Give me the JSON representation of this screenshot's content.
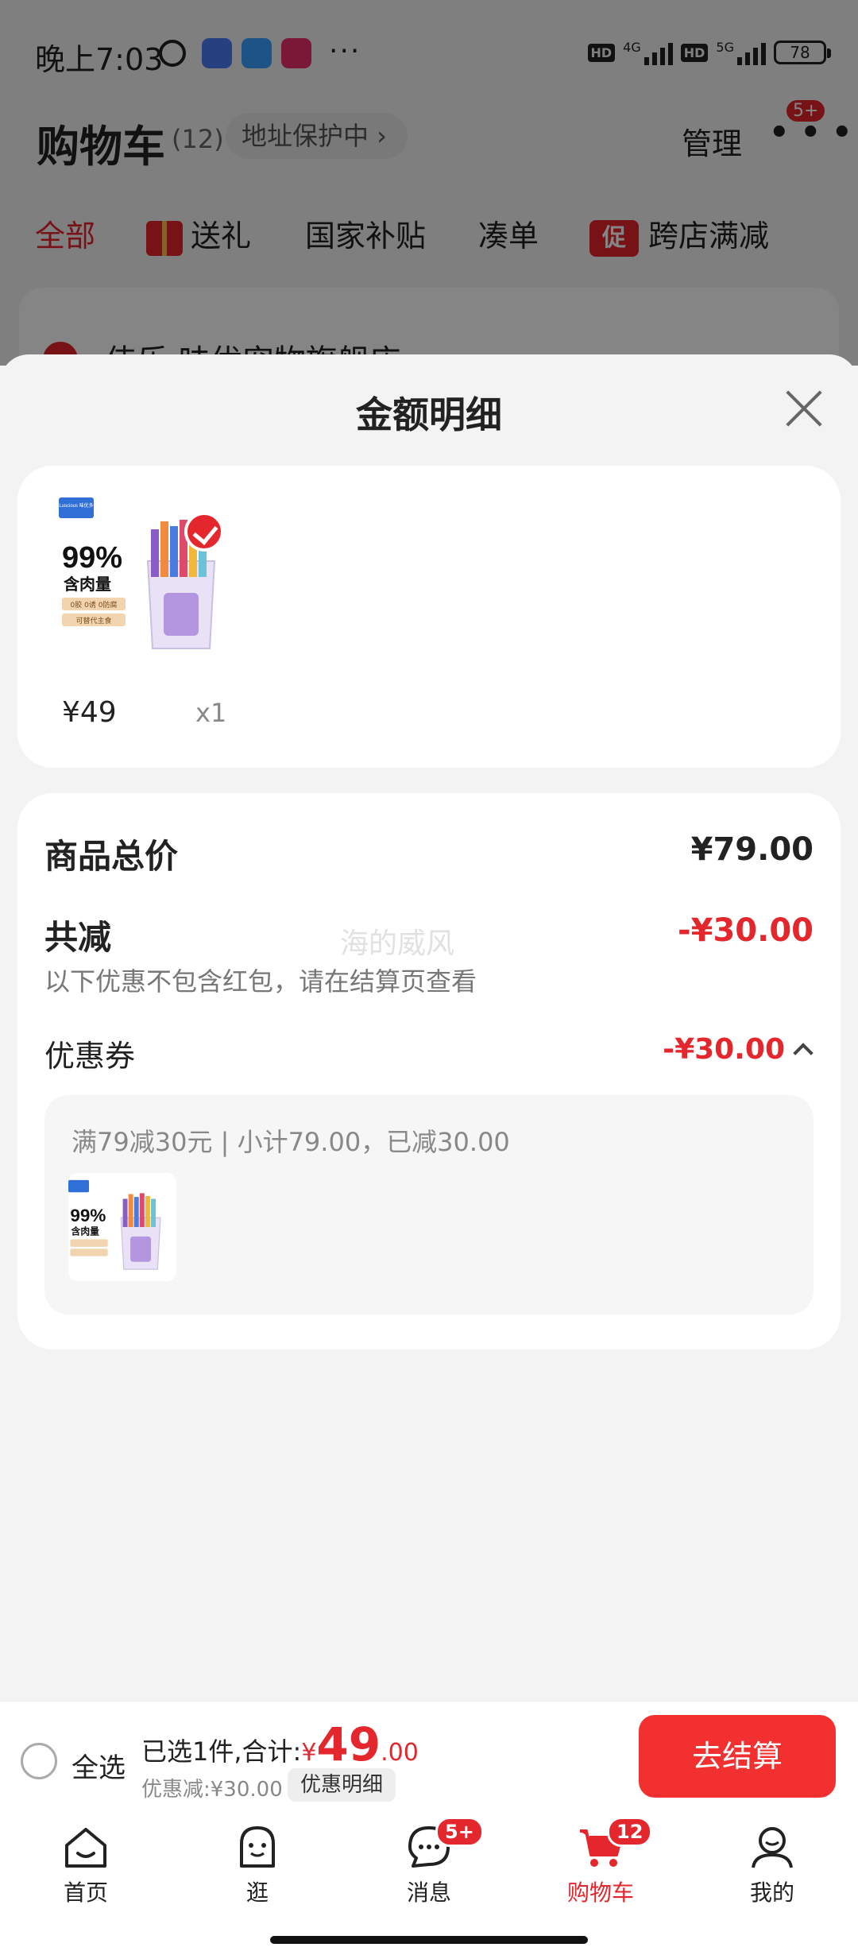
{
  "status_bar": {
    "time": "晚上7:03",
    "dots": "···",
    "hd_label": "HD",
    "net1": "4G",
    "net2": "5G",
    "battery": "78"
  },
  "cart_header": {
    "title": "购物车",
    "count": "(12)",
    "address": "地址保护中 ›",
    "manage": "管理",
    "more_badge": "5+"
  },
  "category_tabs": [
    {
      "label": "全部"
    },
    {
      "label": "送礼"
    },
    {
      "label": "国家补贴"
    },
    {
      "label": "凑单"
    },
    {
      "label": "跨店满减",
      "icon_text": "促"
    }
  ],
  "store": {
    "name": "伟乐 味优宠物旗舰店 ›"
  },
  "sheet": {
    "title": "金额明细",
    "item": {
      "price": "¥49",
      "qty": "x1"
    },
    "total_label": "商品总价",
    "total_value": "¥79.00",
    "discount_label": "共减",
    "discount_value": "-¥30.00",
    "watermark": "海的威风",
    "note": "以下优惠不包含红包，请在结算页查看",
    "coupon_label": "优惠券",
    "coupon_value": "-¥30.00",
    "coupon_desc": "满79减30元 | 小计79.00，已减30.00",
    "product_text": {
      "percent": "99%",
      "meat": "含肉量",
      "claims": "0胶 0诱 0防腐",
      "use": "可替代主食",
      "brand": "Luscious 味优多"
    }
  },
  "checkout": {
    "select_all": "全选",
    "selected_prefix": "已选1件,合计:",
    "currency": "¥",
    "total_int": "49",
    "total_dec": ".00",
    "discount_text": "优惠减:¥30.00",
    "detail_button": "优惠明细",
    "checkout_button": "去结算"
  },
  "tab_bar": {
    "items": [
      {
        "label": "首页",
        "icon": "home-icon"
      },
      {
        "label": "逛",
        "icon": "browse-icon"
      },
      {
        "label": "消息",
        "icon": "message-icon",
        "badge": "5+"
      },
      {
        "label": "购物车",
        "icon": "cart-icon",
        "badge": "12",
        "active": true
      },
      {
        "label": "我的",
        "icon": "profile-icon"
      }
    ]
  },
  "colors": {
    "accent": "#e4262d",
    "checkout": "#f23030"
  }
}
